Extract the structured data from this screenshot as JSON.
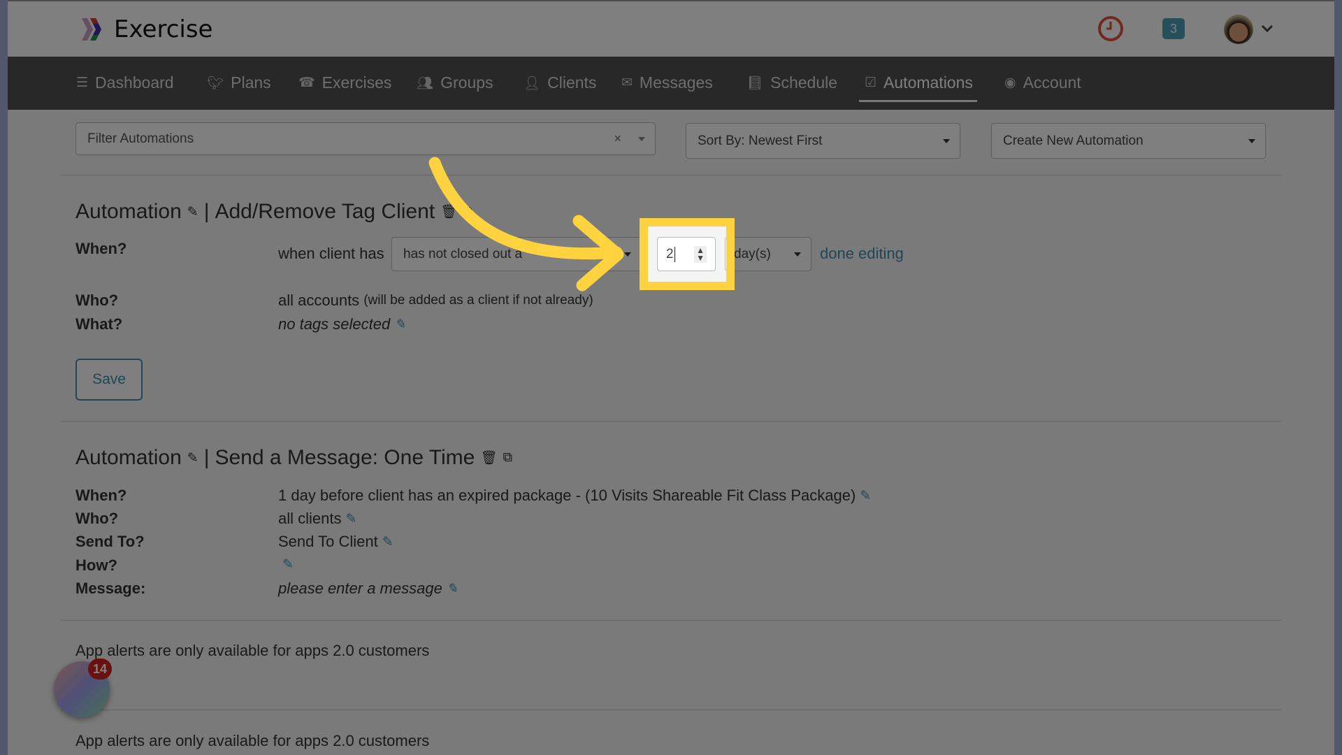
{
  "app": {
    "title": "Exercise",
    "notification_count": "3",
    "floating_badge": "14",
    "colors": {
      "accent": "#3f8fa8",
      "highlight": "#ffd23f",
      "clock": "#e0533a"
    }
  },
  "nav": [
    {
      "label": "Dashboard",
      "icon": "list-icon"
    },
    {
      "label": "Plans",
      "icon": "twitter-bird-icon"
    },
    {
      "label": "Exercises",
      "icon": "phone-icon"
    },
    {
      "label": "Groups",
      "icon": "users-icon"
    },
    {
      "label": "Clients",
      "icon": "user-icon"
    },
    {
      "label": "Messages",
      "icon": "envelope-icon"
    },
    {
      "label": "Schedule",
      "icon": "book-icon"
    },
    {
      "label": "Automations",
      "icon": "check-square-icon",
      "active": true
    },
    {
      "label": "Account",
      "icon": "user-circle-icon"
    }
  ],
  "toolbar": {
    "filter_placeholder": "Filter Automations",
    "sort": "Sort By: Newest First",
    "create": "Create New Automation"
  },
  "automation1": {
    "prefix": "Automation",
    "sep": "|",
    "name": "Add/Remove Tag Client",
    "when_label": "When?",
    "when_prefix": "when client has",
    "condition": "has not closed out a",
    "amount": "2",
    "unit": "day(s)",
    "done": "done editing",
    "who_label": "Who?",
    "who": "all accounts",
    "who_note": "(will be added as a client if not already)",
    "what_label": "What?",
    "what": "no tags selected",
    "save": "Save"
  },
  "automation2": {
    "prefix": "Automation",
    "sep": "|",
    "name": "Send a Message: One Time",
    "rows": [
      {
        "label": "When?",
        "value": "1 day before client has an expired package - (10 Visits Shareable Fit Class Package)",
        "italic": false
      },
      {
        "label": "Who?",
        "value": "all clients",
        "italic": false
      },
      {
        "label": "Send To?",
        "value": "Send To Client",
        "italic": false
      },
      {
        "label": "How?",
        "value": "",
        "italic": false
      },
      {
        "label": "Message:",
        "value": "please enter a message",
        "italic": true
      }
    ]
  },
  "alerts": [
    "App alerts are only available for apps 2.0 customers",
    "App alerts are only available for apps 2.0 customers"
  ]
}
